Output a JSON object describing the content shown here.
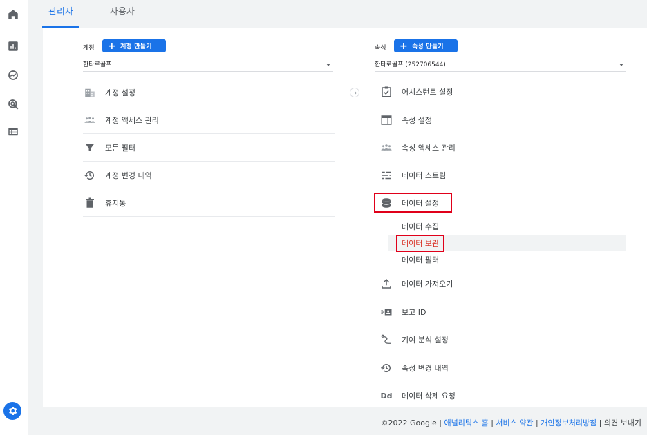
{
  "tabs": {
    "admin": "관리자",
    "user": "사용자"
  },
  "account": {
    "label": "계정",
    "create_button": "계정 만들기",
    "selected": "한타로골프",
    "items": [
      "계정 설정",
      "계정 액세스 관리",
      "모든 필터",
      "계정 변경 내역",
      "휴지통"
    ]
  },
  "property": {
    "label": "속성",
    "create_button": "속성 만들기",
    "selected": "한타로골프 (252706544)",
    "items": [
      "어시스턴트 설정",
      "속성 설정",
      "속성 액세스 관리",
      "데이터 스트림",
      "데이터 설정"
    ],
    "sub_items": [
      "데이터 수집",
      "데이터 보관",
      "데이터 필터"
    ],
    "items_after": [
      "데이터 가져오기",
      "보고 ID",
      "기여 분석 설정",
      "속성 변경 내역",
      "데이터 삭제 요청"
    ]
  },
  "footer": {
    "copyright": "©2022 Google",
    "link_analytics_home": "애널리틱스 홈",
    "link_terms": "서비스 약관",
    "link_privacy": "개인정보처리방침",
    "feedback": "의견 보내기",
    "separator": " | "
  },
  "colors": {
    "accent": "#1a73e8",
    "highlight_box": "#e0001a"
  },
  "icons": {
    "rail": [
      "home-icon",
      "reports-icon",
      "explore-icon",
      "advertising-icon",
      "list-icon",
      "settings-gear-icon"
    ]
  }
}
